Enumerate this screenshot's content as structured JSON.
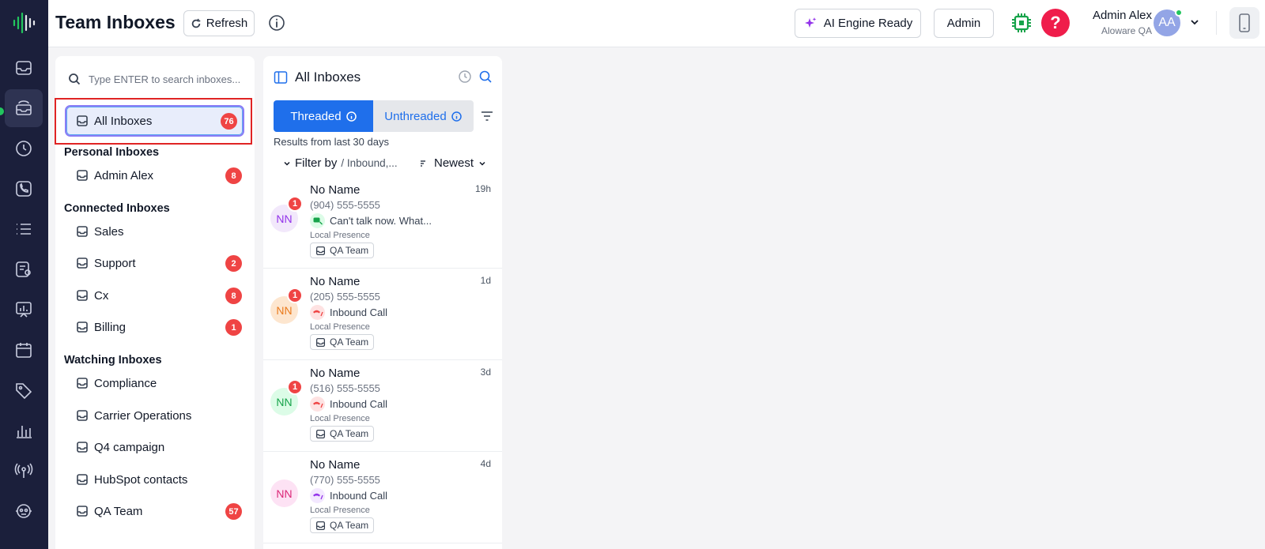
{
  "header": {
    "title": "Team Inboxes",
    "refresh_label": "Refresh",
    "ai_label": "AI Engine Ready",
    "admin_label": "Admin",
    "help_glyph": "?",
    "user_name": "Admin Alex",
    "user_org": "Aloware QA",
    "avatar_initials": "AA"
  },
  "rail": {
    "items": [
      "inbox-icon",
      "team-inbox-icon",
      "history-icon",
      "phone-icon",
      "list-icon",
      "contacts-icon",
      "reports-icon",
      "calendar-icon",
      "tag-icon",
      "analytics-icon",
      "broadcast-icon",
      "integrations-icon"
    ]
  },
  "inboxes": {
    "search_placeholder": "Type ENTER to search inboxes...",
    "all": {
      "label": "All Inboxes",
      "count": "76"
    },
    "personal_heading": "Personal Inboxes",
    "personal": [
      {
        "label": "Admin Alex",
        "count": "8"
      }
    ],
    "connected_heading": "Connected Inboxes",
    "connected": [
      {
        "label": "Sales",
        "count": null
      },
      {
        "label": "Support",
        "count": "2"
      },
      {
        "label": "Cx",
        "count": "8"
      },
      {
        "label": "Billing",
        "count": "1"
      }
    ],
    "watching_heading": "Watching Inboxes",
    "watching": [
      {
        "label": "Compliance",
        "count": null
      },
      {
        "label": "Carrier Operations",
        "count": null
      },
      {
        "label": "Q4 campaign",
        "count": null
      },
      {
        "label": "HubSpot contacts",
        "count": null
      },
      {
        "label": "QA Team",
        "count": "57"
      }
    ]
  },
  "conversations": {
    "title": "All Inboxes",
    "tab_threaded": "Threaded",
    "tab_unthreaded": "Unthreaded",
    "results_text": "Results from last 30 days",
    "filter_label": "Filter by",
    "filter_value": "/ Inbound,...",
    "sort_label": "Newest",
    "items": [
      {
        "name": "No Name",
        "time": "19h",
        "phone": "(904) 555-5555",
        "initials": "NN",
        "unread": "1",
        "message": "Can't talk now. What...",
        "kind": "sms",
        "presence": "Local Presence",
        "team": "QA Team",
        "avatar_bg": "#f2e8fb",
        "avatar_fg": "#9333ea"
      },
      {
        "name": "No Name",
        "time": "1d",
        "phone": "(205) 555-5555",
        "initials": "NN",
        "unread": "1",
        "message": "Inbound Call",
        "kind": "call",
        "presence": "Local Presence",
        "team": "QA Team",
        "avatar_bg": "#fde6cf",
        "avatar_fg": "#ea7a1c"
      },
      {
        "name": "No Name",
        "time": "3d",
        "phone": "(516) 555-5555",
        "initials": "NN",
        "unread": "1",
        "message": "Inbound Call",
        "kind": "call",
        "presence": "Local Presence",
        "team": "QA Team",
        "avatar_bg": "#dcfce7",
        "avatar_fg": "#16a34a"
      },
      {
        "name": "No Name",
        "time": "4d",
        "phone": "(770) 555-5555",
        "initials": "NN",
        "unread": null,
        "message": "Inbound Call",
        "kind": "call",
        "presence": "Local Presence",
        "team": "QA Team",
        "avatar_bg": "#fde2f4",
        "avatar_fg": "#db2777"
      }
    ]
  },
  "colors": {
    "rail_bg": "#1b1f3b",
    "accent_blue": "#1f6feb",
    "badge_red": "#ef4444",
    "online_green": "#22c55e",
    "help_red": "#ef1d4b"
  }
}
